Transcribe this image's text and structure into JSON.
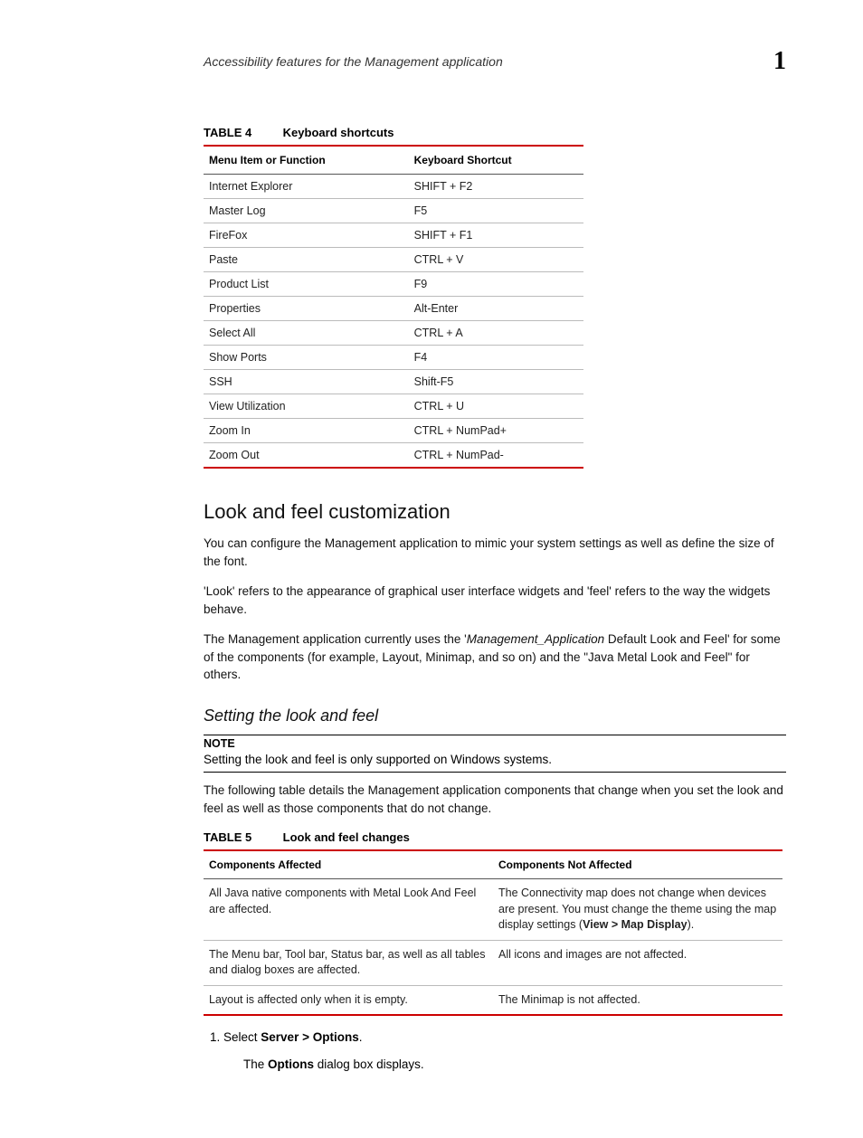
{
  "header": {
    "running_title": "Accessibility features for the Management application",
    "chapter_number": "1"
  },
  "table4": {
    "label": "TABLE 4",
    "title": "Keyboard shortcuts",
    "col1": "Menu Item or Function",
    "col2": "Keyboard Shortcut",
    "rows": [
      {
        "fn": "Internet Explorer",
        "sc": "SHIFT + F2"
      },
      {
        "fn": "Master Log",
        "sc": "F5"
      },
      {
        "fn": "FireFox",
        "sc": "SHIFT + F1"
      },
      {
        "fn": "Paste",
        "sc": "CTRL + V"
      },
      {
        "fn": "Product List",
        "sc": "F9"
      },
      {
        "fn": "Properties",
        "sc": "Alt-Enter"
      },
      {
        "fn": "Select All",
        "sc": "CTRL + A"
      },
      {
        "fn": "Show Ports",
        "sc": "F4"
      },
      {
        "fn": "SSH",
        "sc": "Shift-F5"
      },
      {
        "fn": "View Utilization",
        "sc": "CTRL + U"
      },
      {
        "fn": "Zoom In",
        "sc": "CTRL + NumPad+"
      },
      {
        "fn": "Zoom Out",
        "sc": "CTRL + NumPad-"
      }
    ]
  },
  "section": {
    "heading": "Look and feel customization",
    "para1": "You can configure the Management application to mimic your system settings as well as define the size of the font.",
    "para2": "'Look' refers to the appearance of graphical user interface widgets and 'feel' refers to the way the widgets behave.",
    "para3_pre": "The Management application currently uses the '",
    "para3_em": "Management_Application",
    "para3_post": " Default Look and Feel' for some of the components (for example, Layout, Minimap, and so on) and the \"Java Metal Look and Feel\" for others."
  },
  "subsection": {
    "heading": "Setting the look and feel",
    "note_label": "NOTE",
    "note_text": "Setting the look and feel is only supported on Windows systems.",
    "para": "The following table details the Management application components that change when you set the look and feel as well as those components that do not change."
  },
  "table5": {
    "label": "TABLE 5",
    "title": "Look and feel changes",
    "col1": "Components Affected",
    "col2": "Components Not Affected",
    "rows": [
      {
        "aff": "All Java native components with Metal Look And Feel are affected.",
        "naff_pre": "The Connectivity map does not change when devices are present. You must change the theme using the map display settings (",
        "naff_bold": "View > Map Display",
        "naff_post": ")."
      },
      {
        "aff": "The Menu bar, Tool bar, Status bar, as well as all tables and dialog boxes are affected.",
        "naff_pre": "All icons and images are not affected.",
        "naff_bold": "",
        "naff_post": ""
      },
      {
        "aff": "Layout is affected only when it is empty.",
        "naff_pre": "The Minimap is not affected.",
        "naff_bold": "",
        "naff_post": ""
      }
    ]
  },
  "steps": {
    "s1_pre": "Select ",
    "s1_bold": "Server > Options",
    "s1_post": ".",
    "s1_sub_pre": "The ",
    "s1_sub_bold": "Options",
    "s1_sub_post": " dialog box displays."
  }
}
